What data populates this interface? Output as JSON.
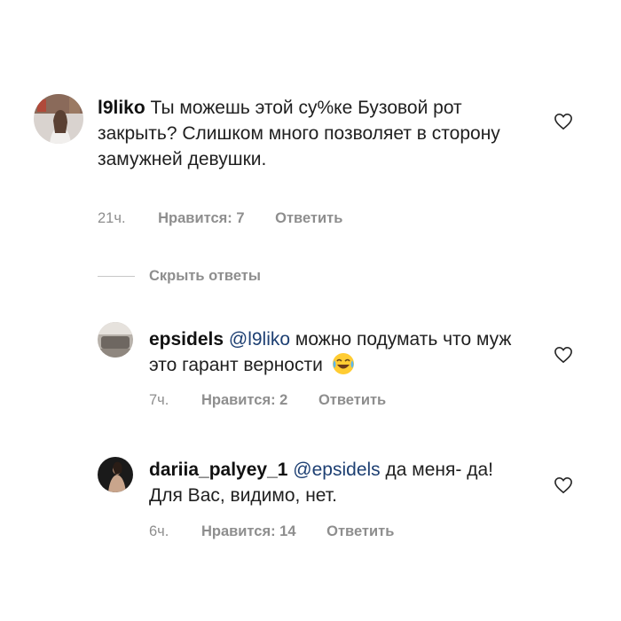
{
  "comments": [
    {
      "username": "l9liko",
      "text": "Ты можешь этой су%ке Бузовой рот закрыть? Слишком много позволяет в сторону замужней девушки.",
      "time": "21ч.",
      "likes_label": "Нравится: 7",
      "reply_label": "Ответить"
    },
    {
      "username": "epsidels",
      "mention": "@l9liko",
      "text": "можно подумать что муж это гарант верности",
      "emoji": "face-with-tears-of-joy",
      "time": "7ч.",
      "likes_label": "Нравится: 2",
      "reply_label": "Ответить"
    },
    {
      "username": "dariia_palyey_1",
      "mention": "@epsidels",
      "text": "да меня- да! Для Вас, видимо, нет.",
      "time": "6ч.",
      "likes_label": "Нравится: 14",
      "reply_label": "Ответить"
    }
  ],
  "hide_replies_label": "Скрыть ответы",
  "icons": {
    "like": "heart-icon"
  },
  "colors": {
    "meta": "#8e8e8e",
    "mention": "#1d3f72",
    "text": "#1f1f1f"
  }
}
